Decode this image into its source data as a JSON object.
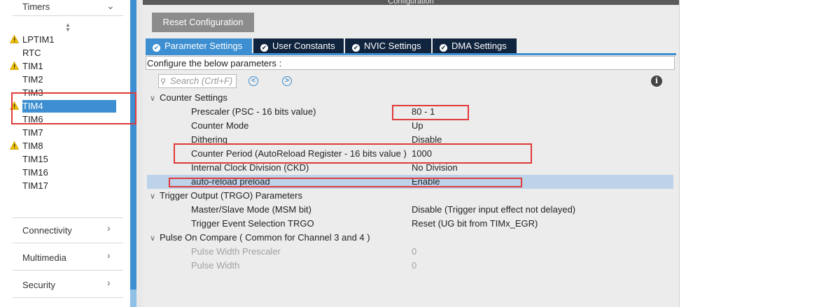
{
  "sidebar": {
    "timers_label": "Timers",
    "sort_icon": "up-down-arrows",
    "items": [
      {
        "label": "LPTIM1",
        "warn": true
      },
      {
        "label": "RTC",
        "warn": false
      },
      {
        "label": "TIM1",
        "warn": true
      },
      {
        "label": "TIM2",
        "warn": false
      },
      {
        "label": "TIM3",
        "warn": false
      },
      {
        "label": "TIM4",
        "warn": true,
        "selected": true
      },
      {
        "label": "TIM6",
        "warn": false
      },
      {
        "label": "TIM7",
        "warn": false
      },
      {
        "label": "TIM8",
        "warn": true
      },
      {
        "label": "TIM15",
        "warn": false
      },
      {
        "label": "TIM16",
        "warn": false
      },
      {
        "label": "TIM17",
        "warn": false
      }
    ],
    "categories": [
      "Connectivity",
      "Multimedia",
      "Security"
    ]
  },
  "panel": {
    "title": "Configuration",
    "reset_label": "Reset Configuration",
    "tabs": [
      "Parameter Settings",
      "User Constants",
      "NVIC Settings",
      "DMA Settings"
    ],
    "describe": "Configure the below parameters :",
    "search_placeholder": "Search (Crtl+F)"
  },
  "groups": {
    "counter": {
      "title": "Counter Settings",
      "rows": [
        {
          "label": "Prescaler (PSC - 16 bits value)",
          "value": "80 - 1"
        },
        {
          "label": "Counter Mode",
          "value": "Up"
        },
        {
          "label": "Dithering",
          "value": "Disable"
        },
        {
          "label": "Counter Period (AutoReload Register - 16 bits value )",
          "value": "1000"
        },
        {
          "label": "Internal Clock Division (CKD)",
          "value": "No Division"
        },
        {
          "label": "auto-reload preload",
          "value": "Enable"
        }
      ]
    },
    "trigger": {
      "title": "Trigger Output (TRGO) Parameters",
      "rows": [
        {
          "label": "Master/Slave Mode (MSM bit)",
          "value": "Disable (Trigger input effect not delayed)"
        },
        {
          "label": "Trigger Event Selection TRGO",
          "value": "Reset (UG bit from TIMx_EGR)"
        }
      ]
    },
    "pulse": {
      "title": "Pulse On Compare ( Common for Channel 3 and 4 )",
      "rows": [
        {
          "label": "Pulse Width Prescaler",
          "value": "0"
        },
        {
          "label": "Pulse Width",
          "value": "0"
        }
      ]
    }
  },
  "colors": {
    "accent": "#3d8fd1",
    "tab_dark": "#11243e",
    "highlight": "#e03a3a",
    "selected_row": "#bdd3ea"
  }
}
